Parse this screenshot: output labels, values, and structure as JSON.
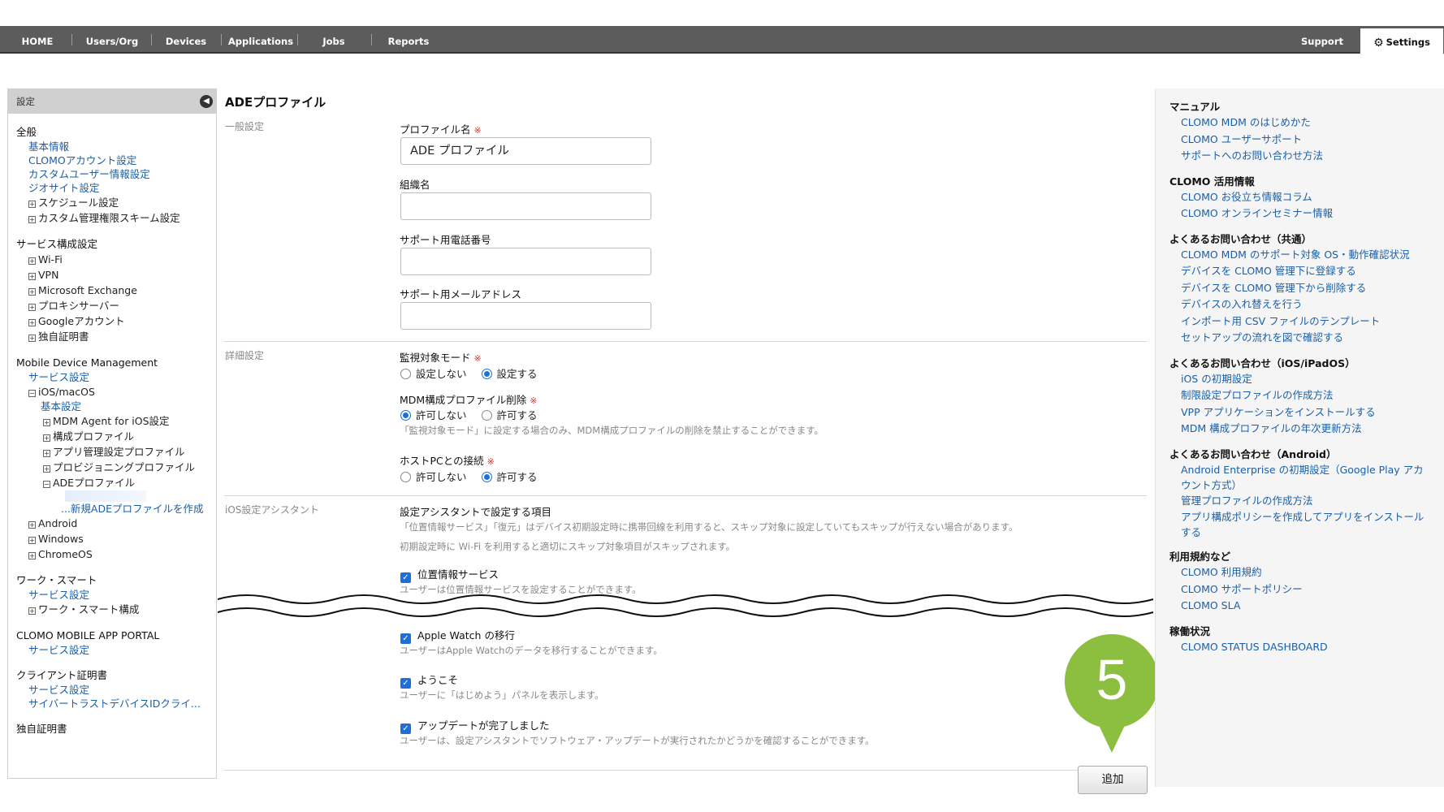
{
  "nav": {
    "items": [
      "HOME",
      "Users/Org",
      "Devices",
      "Applications",
      "Jobs",
      "Reports"
    ],
    "support": "Support",
    "settings": "Settings"
  },
  "sidebar": {
    "header": "設定",
    "general": {
      "title": "全般",
      "links": [
        "基本情報",
        "CLOMOアカウント設定",
        "カスタムユーザー情報設定",
        "ジオサイト設定"
      ],
      "expandables": [
        "スケジュール設定",
        "カスタム管理権限スキーム設定"
      ]
    },
    "service": {
      "title": "サービス構成設定",
      "expandables": [
        "Wi-Fi",
        "VPN",
        "Microsoft Exchange",
        "プロキシサーバー",
        "Googleアカウント",
        "独自証明書"
      ]
    },
    "mdm": {
      "title": "Mobile Device Management",
      "service_link": "サービス設定",
      "ios_label": "iOS/macOS",
      "ios_basic": "基本設定",
      "ios_items": [
        "MDM Agent for iOS設定",
        "構成プロファイル",
        "アプリ管理設定プロファイル",
        "プロビジョニングプロファイル"
      ],
      "ade_label": "ADEプロファイル",
      "ade_new": "...新規ADEプロファイルを作成",
      "others": [
        "Android",
        "Windows",
        "ChromeOS"
      ]
    },
    "work_smart": {
      "title": "ワーク・スマート",
      "link": "サービス設定",
      "expandable": "ワーク・スマート構成"
    },
    "portal": {
      "title": "CLOMO MOBILE APP PORTAL",
      "link": "サービス設定"
    },
    "client_cert": {
      "title": "クライアント証明書",
      "links": [
        "サービス設定",
        "サイバートラストデバイスIDクライ..."
      ]
    },
    "own_cert": {
      "title": "独自証明書"
    }
  },
  "main": {
    "title": "ADEプロファイル",
    "general": {
      "label": "一般設定",
      "profile_name_label": "プロファイル名",
      "profile_name_value": "ADE プロファイル",
      "org_label": "組織名",
      "org_value": "",
      "phone_label": "サポート用電話番号",
      "phone_value": "",
      "email_label": "サポート用メールアドレス",
      "email_value": "",
      "required_mark": "※"
    },
    "detail": {
      "label": "詳細設定",
      "supervised_label": "監視対象モード",
      "supervised_options": [
        "設定しない",
        "設定する"
      ],
      "supervised_selected": 1,
      "mdm_remove_label": "MDM構成プロファイル削除",
      "mdm_remove_options": [
        "許可しない",
        "許可する"
      ],
      "mdm_remove_selected": 0,
      "mdm_remove_hint": "「監視対象モード」に設定する場合のみ、MDM構成プロファイルの削除を禁止することができます。",
      "host_label": "ホストPCとの接続",
      "host_options": [
        "許可しない",
        "許可する"
      ],
      "host_selected": 1
    },
    "assistant": {
      "label": "iOS設定アシスタント",
      "heading": "設定アシスタントで設定する項目",
      "hint1": "「位置情報サービス」「復元」はデバイス初期設定時に携帯回線を利用すると、スキップ対象に設定していてもスキップが行えない場合があります。",
      "hint2": "初期設定時に Wi-Fi を利用すると適切にスキップ対象項目がスキップされます。",
      "items": [
        {
          "label": "位置情報サービス",
          "desc": "ユーザーは位置情報サービスを設定することができます。"
        },
        {
          "label": "Apple Watch の移行",
          "desc": "ユーザーはApple Watchのデータを移行することができます。"
        },
        {
          "label": "ようこそ",
          "desc": "ユーザーに「はじめよう」パネルを表示します。"
        },
        {
          "label": "アップデートが完了しました",
          "desc": "ユーザーは、設定アシスタントでソフトウェア・アップデートが実行されたかどうかを確認することができます。"
        }
      ]
    },
    "add_button": "追加",
    "step_number": "5"
  },
  "rightbar": {
    "groups": [
      {
        "heading": "マニュアル",
        "links": [
          "CLOMO MDM のはじめかた",
          "CLOMO ユーザーサポート",
          "サポートへのお問い合わせ方法"
        ]
      },
      {
        "heading": "CLOMO 活用情報",
        "links": [
          "CLOMO お役立ち情報コラム",
          "CLOMO オンラインセミナー情報"
        ]
      },
      {
        "heading": "よくあるお問い合わせ（共通）",
        "links": [
          "CLOMO MDM のサポート対象 OS・動作確認状況",
          "デバイスを CLOMO 管理下に登録する",
          "デバイスを CLOMO 管理下から削除する",
          "デバイスの入れ替えを行う",
          "インポート用 CSV ファイルのテンプレート",
          "セットアップの流れを図で確認する"
        ]
      },
      {
        "heading": "よくあるお問い合わせ（iOS/iPadOS）",
        "links": [
          "iOS の初期設定",
          "制限設定プロファイルの作成方法",
          "VPP アプリケーションをインストールする",
          "MDM 構成プロファイルの年次更新方法"
        ]
      },
      {
        "heading": "よくあるお問い合わせ（Android）",
        "links": [
          "Android Enterprise の初期設定（Google Play アカウント方式）",
          "管理プロファイルの作成方法",
          "アプリ構成ポリシーを作成してアプリをインストールする"
        ]
      },
      {
        "heading": "利用規約など",
        "links": [
          "CLOMO 利用規約",
          "CLOMO サポートポリシー",
          "CLOMO SLA"
        ]
      },
      {
        "heading": "稼働状況",
        "links": [
          "CLOMO STATUS DASHBOARD"
        ]
      }
    ]
  },
  "colors": {
    "nav_bg": "#5c5c5c",
    "link": "#1a5fa8",
    "accent": "#1f6fd6",
    "required": "#d9332b",
    "step_marker": "#8cbf3f"
  }
}
